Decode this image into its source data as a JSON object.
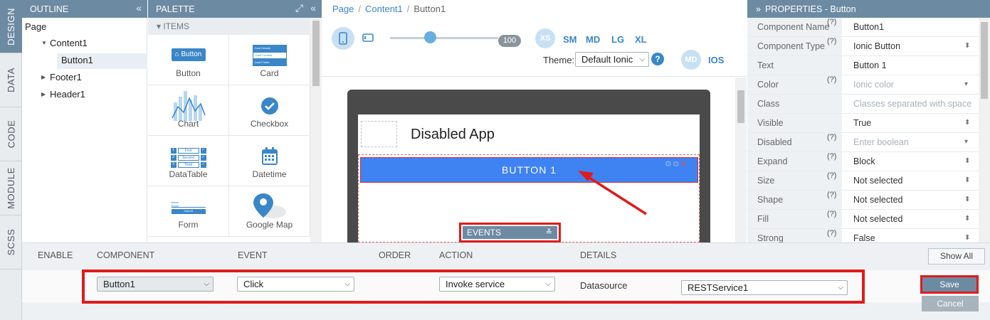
{
  "left_tabs": [
    "DESIGN",
    "DATA",
    "CODE",
    "MODULE",
    "SCSS"
  ],
  "outline": {
    "title": "OUTLINE",
    "tree": {
      "root": "Page",
      "content": "Content1",
      "button": "Button1",
      "footer": "Footer1",
      "header": "Header1"
    }
  },
  "palette": {
    "title": "PALETTE",
    "section": "ITEMS",
    "items": [
      "Button",
      "Card",
      "Chart",
      "Checkbox",
      "DataTable",
      "Datetime",
      "Form",
      "Google Map"
    ],
    "button_icon_text": "Button",
    "card_icon_lines": [
      "Card Header",
      "Card Content",
      "Card Footer"
    ],
    "datatable_icon_rows": [
      "1",
      "First",
      "2",
      "Second",
      "3",
      "Third"
    ],
    "form_icon_lines": [
      "Name",
      "Email",
      "Submit"
    ]
  },
  "breadcrumb": {
    "page": "Page",
    "content": "Content1",
    "current": "Button1",
    "sep": "/"
  },
  "toolbar": {
    "zoom_value": "100",
    "zoom_level": 0.63,
    "sizes": [
      "XS",
      "SM",
      "MD",
      "LG",
      "XL"
    ],
    "theme_label": "Theme:",
    "theme_value": "Default Ionic",
    "help": "?",
    "platform_md": "MD",
    "platform_ios": "IOS"
  },
  "canvas": {
    "app_title": "Disabled App",
    "button_label": "BUTTON 1",
    "events_label": "EVENTS"
  },
  "properties": {
    "title": "PROPERTIES - Button",
    "rows": [
      {
        "name": "Component Name",
        "q": "(?)",
        "value": "Button1",
        "placeholder": false,
        "dropdown": ""
      },
      {
        "name": "Component Type",
        "q": "(?)",
        "value": "Ionic Button",
        "placeholder": false,
        "dropdown": "updown"
      },
      {
        "name": "Text",
        "q": "",
        "value": "Button 1",
        "placeholder": false,
        "dropdown": ""
      },
      {
        "name": "Color",
        "q": "(?)",
        "value": "Ionic color",
        "placeholder": true,
        "dropdown": "down"
      },
      {
        "name": "Class",
        "q": "",
        "value": "Classes separated with space",
        "placeholder": true,
        "dropdown": ""
      },
      {
        "name": "Visible",
        "q": "",
        "value": "True",
        "placeholder": false,
        "dropdown": "updown"
      },
      {
        "name": "Disabled",
        "q": "(?)",
        "value": "Enter boolean",
        "placeholder": true,
        "dropdown": "down"
      },
      {
        "name": "Expand",
        "q": "(?)",
        "value": "Block",
        "placeholder": false,
        "dropdown": "updown"
      },
      {
        "name": "Size",
        "q": "(?)",
        "value": "Not selected",
        "placeholder": false,
        "dropdown": "updown"
      },
      {
        "name": "Shape",
        "q": "(?)",
        "value": "Not selected",
        "placeholder": false,
        "dropdown": "updown"
      },
      {
        "name": "Fill",
        "q": "(?)",
        "value": "Not selected",
        "placeholder": false,
        "dropdown": "updown"
      },
      {
        "name": "Strong",
        "q": "(?)",
        "value": "False",
        "placeholder": false,
        "dropdown": "updown"
      }
    ]
  },
  "events_panel": {
    "headers": {
      "enable": "ENABLE",
      "component": "COMPONENT",
      "event": "EVENT",
      "order": "ORDER",
      "action": "ACTION",
      "details": "DETAILS"
    },
    "show_all": "Show All",
    "row": {
      "component": "Button1",
      "event": "Click",
      "action": "Invoke service",
      "details_label": "Datasource",
      "datasource": "RESTService1"
    },
    "save": "Save",
    "cancel": "Cancel"
  },
  "colors": {
    "header_bg": "#6d8aa3",
    "accent_blue": "#3a86c8",
    "button_blue": "#3f82f2",
    "highlight_red": "#e01b1b"
  }
}
